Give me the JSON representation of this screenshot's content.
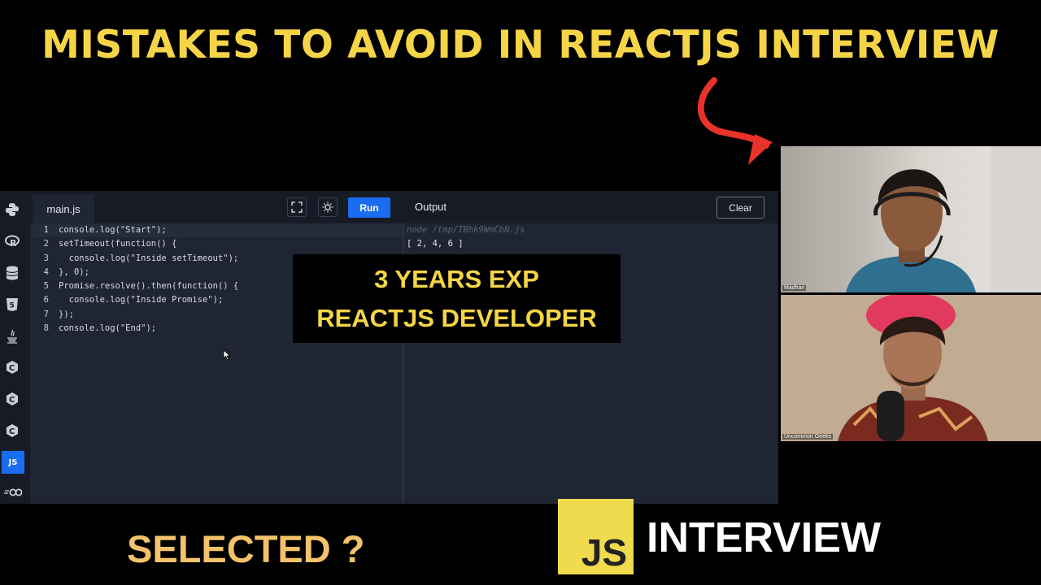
{
  "headline": "MISTAKES TO AVOID IN REACTJS INTERVIEW",
  "colors": {
    "headline": "#f5d547",
    "arrow": "#e8322a",
    "run": "#1a6cf0",
    "selected": "#f4c26b",
    "js_logo": "#f0db4f"
  },
  "editor": {
    "tab_label": "main.js",
    "run_label": "Run",
    "output_label": "Output",
    "clear_label": "Clear",
    "sidebar_icons": [
      "python-icon",
      "r-icon",
      "database-icon",
      "html5-icon",
      "java-icon",
      "c-icon",
      "cpp-icon",
      "csharp-icon",
      "JS",
      "go-icon"
    ],
    "active_language": "JS",
    "code_lines": [
      {
        "no": "1",
        "text": "console.log(\"Start\");"
      },
      {
        "no": "2",
        "text": "setTimeout(function() {"
      },
      {
        "no": "3",
        "text": "  console.log(\"Inside setTimeout\");"
      },
      {
        "no": "4",
        "text": "}, 0);"
      },
      {
        "no": "5",
        "text": "Promise.resolve().then(function() {"
      },
      {
        "no": "6",
        "text": "  console.log(\"Inside Promise\");"
      },
      {
        "no": "7",
        "text": "});"
      },
      {
        "no": "8",
        "text": "console.log(\"End\");"
      }
    ],
    "output_command": "node /tmp/TBhk9WmCbN.js",
    "output_result": "[ 2, 4, 6 ]"
  },
  "overlay": {
    "line1": "3 YEARS EXP",
    "line2": "REACTJS DEVELOPER"
  },
  "participants": [
    {
      "name": "Madhan"
    },
    {
      "name": "Uncommon Geeks"
    }
  ],
  "bottom": {
    "selected": "SELECTED ?",
    "js_logo": "JS",
    "interview": "INTERVIEW"
  }
}
